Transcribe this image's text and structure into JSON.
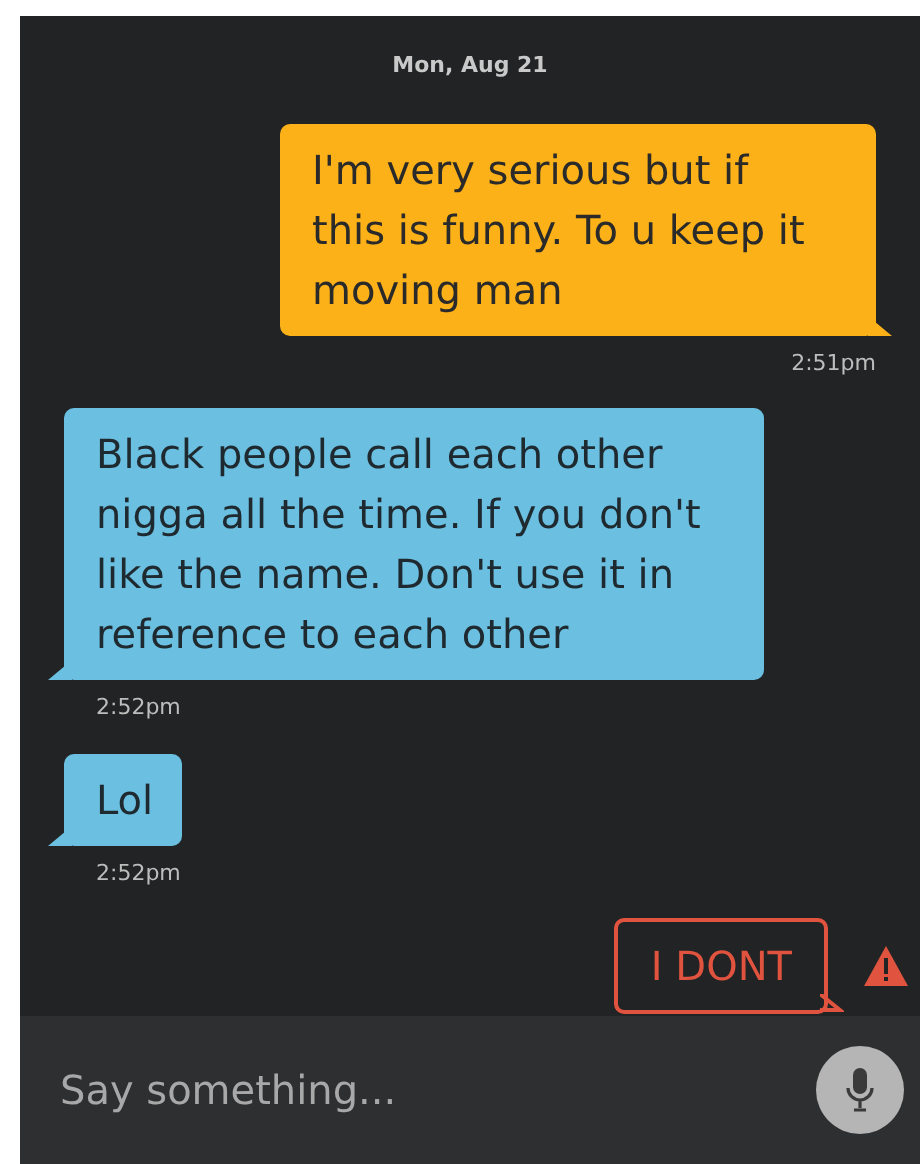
{
  "date_header": "Mon, Aug 21",
  "messages": [
    {
      "kind": "sent",
      "text": "I'm very serious but if this is funny. To u keep it moving man",
      "time": "2:51pm",
      "failed": false
    },
    {
      "kind": "received",
      "text": "Black people call each other nigga all the time. If you don't like the name. Don't use it in reference to each other",
      "time": "2:52pm",
      "failed": false
    },
    {
      "kind": "received",
      "text": "Lol",
      "time": "2:52pm",
      "failed": false
    },
    {
      "kind": "sent",
      "text": "I DONT",
      "failed": true
    }
  ],
  "composer": {
    "placeholder": "Say something..."
  }
}
